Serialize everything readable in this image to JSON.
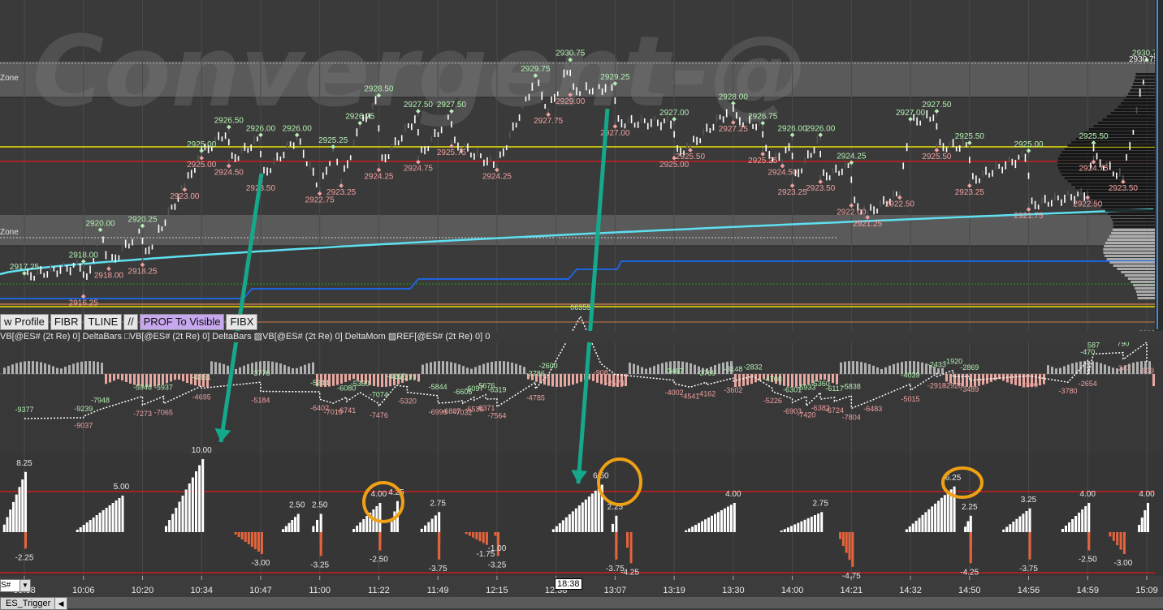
{
  "watermark": "Convergent-@",
  "zones": [
    "Zone",
    "Zone"
  ],
  "toolbar": [
    {
      "label": "w Profile",
      "active": false,
      "icon": null
    },
    {
      "label": "FIBR",
      "active": false,
      "icon": null
    },
    {
      "label": "TLINE",
      "active": false,
      "icon": null
    },
    {
      "label": "",
      "active": false,
      "icon": "parallel-lines-icon"
    },
    {
      "label": "PROF To Visible",
      "active": true,
      "icon": null
    },
    {
      "label": "FIBX",
      "active": false,
      "icon": null
    }
  ],
  "study_bar": "VB[@ES# (2t Re) 0] DeltaBars □VB[@ES# (2t Re) 0] DeltaBars ▨VB[@ES# (2t Re) 0] DeltaMom ▨REF[@ES# (2t Re) 0] 0",
  "time_axis": [
    "09:58",
    "10:06",
    "10:20",
    "10:34",
    "10:47",
    "11:00",
    "11:22",
    "11:49",
    "12:15",
    "12:38",
    "13:07",
    "13:19",
    "13:30",
    "14:00",
    "14:21",
    "14:32",
    "14:50",
    "14:56",
    "14:59",
    "15:09"
  ],
  "time_cursor": "18:38",
  "symbol_box": "S#",
  "bottom_tab": "ES_Trigger",
  "colors": {
    "background": "#3a3a3a",
    "highs": "#b4f0b4",
    "lows": "#f0a0a0",
    "vwap": "#5ee0f0",
    "blue_line": "#1e64dc",
    "yellow": "#f0e600",
    "red": "#c81e1e",
    "up_bar": "#ffffff",
    "down_bar": "#e6643c",
    "arrow": "#16a88a",
    "circle": "#f0a014"
  },
  "chart_data": [
    {
      "type": "price-bars",
      "price_labels_high": [
        {
          "label": "2917.25",
          "x": "09:58"
        },
        {
          "label": "2918.00",
          "x": "10:06"
        },
        {
          "label": "2920.00",
          "x": "10:10"
        },
        {
          "label": "2920.25",
          "x": "10:20"
        },
        {
          "label": "2925.00",
          "x": "10:34"
        },
        {
          "label": "2926.50",
          "x": "10:40"
        },
        {
          "label": "2926.00",
          "x": "10:47"
        },
        {
          "label": "2926.00",
          "x": "10:55"
        },
        {
          "label": "2925.25",
          "x": "11:05"
        },
        {
          "label": "2926.75",
          "x": "11:15"
        },
        {
          "label": "2928.50",
          "x": "11:22"
        },
        {
          "label": "2927.50",
          "x": "11:40"
        },
        {
          "label": "2927.50",
          "x": "11:55"
        },
        {
          "label": "2929.75",
          "x": "12:30"
        },
        {
          "label": "2930.75",
          "x": "12:45"
        },
        {
          "label": "2929.25",
          "x": "13:07"
        },
        {
          "label": "2927.00",
          "x": "13:19"
        },
        {
          "label": "2928.00",
          "x": "13:30"
        },
        {
          "label": "2926.75",
          "x": "13:45"
        },
        {
          "label": "2926.00",
          "x": "14:00"
        },
        {
          "label": "2926.00",
          "x": "14:10"
        },
        {
          "label": "2924.25",
          "x": "14:21"
        },
        {
          "label": "2927.00",
          "x": "14:32"
        },
        {
          "label": "2927.50",
          "x": "14:40"
        },
        {
          "label": "2925.50",
          "x": "14:50"
        },
        {
          "label": "2925.00",
          "x": "14:56"
        },
        {
          "label": "2925.50",
          "x": "15:00"
        },
        {
          "label": "2930.75",
          "x": "15:09"
        }
      ],
      "price_labels_low": [
        {
          "label": "2916.25",
          "x": "10:06"
        },
        {
          "label": "2918.00",
          "x": "10:12"
        },
        {
          "label": "2918.25",
          "x": "10:20"
        },
        {
          "label": "2923.00",
          "x": "10:30"
        },
        {
          "label": "2925.00",
          "x": "10:34"
        },
        {
          "label": "2924.50",
          "x": "10:40"
        },
        {
          "label": "2923.50",
          "x": "10:47"
        },
        {
          "label": "2922.75",
          "x": "11:00"
        },
        {
          "label": "2923.25",
          "x": "11:08"
        },
        {
          "label": "2924.25",
          "x": "11:22"
        },
        {
          "label": "2924.75",
          "x": "11:40"
        },
        {
          "label": "2925.75",
          "x": "11:55"
        },
        {
          "label": "2924.25",
          "x": "12:15"
        },
        {
          "label": "2927.75",
          "x": "12:35"
        },
        {
          "label": "2929.00",
          "x": "12:45"
        },
        {
          "label": "2927.00",
          "x": "13:07"
        },
        {
          "label": "2925.00",
          "x": "13:19"
        },
        {
          "label": "2925.50",
          "x": "13:22"
        },
        {
          "label": "2927.25",
          "x": "13:30"
        },
        {
          "label": "2925.25",
          "x": "13:45"
        },
        {
          "label": "2924.50",
          "x": "13:55"
        },
        {
          "label": "2923.25",
          "x": "14:00"
        },
        {
          "label": "2923.50",
          "x": "14:10"
        },
        {
          "label": "2922.00",
          "x": "14:21"
        },
        {
          "label": "2921.25",
          "x": "14:24"
        },
        {
          "label": "2922.50",
          "x": "14:30"
        },
        {
          "label": "2925.50",
          "x": "14:40"
        },
        {
          "label": "2923.25",
          "x": "14:50"
        },
        {
          "label": "2921.75",
          "x": "14:56"
        },
        {
          "label": "2922.50",
          "x": "14:59"
        },
        {
          "label": "2924.75",
          "x": "15:00"
        },
        {
          "label": "2923.50",
          "x": "15:05"
        }
      ],
      "right_axis_label": "2930.75"
    },
    {
      "type": "line",
      "name": "DeltaMom",
      "labels_high": [
        {
          "label": "-9377",
          "x": "09:58"
        },
        {
          "label": "-9239",
          "x": "10:06"
        },
        {
          "label": "-7948",
          "x": "10:10"
        },
        {
          "label": "-5946",
          "x": "10:20"
        },
        {
          "label": "-5937",
          "x": "10:25"
        },
        {
          "label": "-4351",
          "x": "10:34"
        },
        {
          "label": "-3776",
          "x": "10:47"
        },
        {
          "label": "-5244",
          "x": "11:00"
        },
        {
          "label": "-6080",
          "x": "11:10"
        },
        {
          "label": "-5360",
          "x": "11:15"
        },
        {
          "label": "-7074",
          "x": "11:22"
        },
        {
          "label": "-4267",
          "x": "11:30"
        },
        {
          "label": "-4477",
          "x": "11:35"
        },
        {
          "label": "-5844",
          "x": "11:49"
        },
        {
          "label": "-6606",
          "x": "12:00"
        },
        {
          "label": "-6097",
          "x": "12:05"
        },
        {
          "label": "-5676",
          "x": "12:10"
        },
        {
          "label": "-6319",
          "x": "12:15"
        },
        {
          "label": "-3786",
          "x": "12:30"
        },
        {
          "label": "-2600",
          "x": "12:35"
        },
        {
          "label": "06359",
          "x": "12:50"
        },
        {
          "label": "-3467",
          "x": "13:19"
        },
        {
          "label": "-3769",
          "x": "13:25"
        },
        {
          "label": "-3148",
          "x": "13:30"
        },
        {
          "label": "-2832",
          "x": "13:40"
        },
        {
          "label": "-4708",
          "x": "13:50"
        },
        {
          "label": "-6301",
          "x": "14:00"
        },
        {
          "label": "-5933",
          "x": "14:05"
        },
        {
          "label": "-5360",
          "x": "14:10"
        },
        {
          "label": "-6117",
          "x": "14:15"
        },
        {
          "label": "-5838",
          "x": "14:21"
        },
        {
          "label": "-4039",
          "x": "14:32"
        },
        {
          "label": "-2433",
          "x": "14:40"
        },
        {
          "label": "-1920",
          "x": "14:45"
        },
        {
          "label": "-2869",
          "x": "14:50"
        },
        {
          "label": "-470",
          "x": "14:59"
        },
        {
          "label": "587",
          "x": "15:00"
        },
        {
          "label": "790",
          "x": "15:05"
        },
        {
          "label": "2362",
          "x": "15:09"
        }
      ],
      "labels_low": [
        {
          "label": "-9037",
          "x": "10:06"
        },
        {
          "label": "-7273",
          "x": "10:20"
        },
        {
          "label": "-7065",
          "x": "10:25"
        },
        {
          "label": "-4695",
          "x": "10:34"
        },
        {
          "label": "-5184",
          "x": "10:47"
        },
        {
          "label": "-6402",
          "x": "11:00"
        },
        {
          "label": "-7010",
          "x": "11:05"
        },
        {
          "label": "-6741",
          "x": "11:10"
        },
        {
          "label": "-7476",
          "x": "11:22"
        },
        {
          "label": "-5320",
          "x": "11:35"
        },
        {
          "label": "-6996",
          "x": "11:49"
        },
        {
          "label": "-6887",
          "x": "11:55"
        },
        {
          "label": "-7032",
          "x": "12:00"
        },
        {
          "label": "-6536",
          "x": "12:05"
        },
        {
          "label": "-6371",
          "x": "12:10"
        },
        {
          "label": "-7564",
          "x": "12:15"
        },
        {
          "label": "-4785",
          "x": "12:30"
        },
        {
          "label": "-908",
          "x": "13:00"
        },
        {
          "label": "-2574",
          "x": "13:07"
        },
        {
          "label": "-4002",
          "x": "13:19"
        },
        {
          "label": "-4541",
          "x": "13:22"
        },
        {
          "label": "-4162",
          "x": "13:25"
        },
        {
          "label": "-3602",
          "x": "13:30"
        },
        {
          "label": "-5226",
          "x": "13:50"
        },
        {
          "label": "-6903",
          "x": "14:00"
        },
        {
          "label": "-7420",
          "x": "14:05"
        },
        {
          "label": "-6382",
          "x": "14:10"
        },
        {
          "label": "-6724",
          "x": "14:15"
        },
        {
          "label": "-7804",
          "x": "14:21"
        },
        {
          "label": "-6483",
          "x": "14:25"
        },
        {
          "label": "-5015",
          "x": "14:32"
        },
        {
          "label": "-2918",
          "x": "14:40"
        },
        {
          "label": "-2928",
          "x": "14:45"
        },
        {
          "label": "-3489",
          "x": "14:50"
        },
        {
          "label": "-2800",
          "x": "14:56"
        },
        {
          "label": "-3780",
          "x": "14:58"
        },
        {
          "label": "-2654",
          "x": "14:59"
        },
        {
          "label": "-247",
          "x": "15:05"
        },
        {
          "label": "-609",
          "x": "15:09"
        }
      ]
    },
    {
      "type": "bar",
      "name": "DeltaBars",
      "labels_high": [
        {
          "label": "8.25",
          "x": "09:58"
        },
        {
          "label": "5.00",
          "x": "10:15"
        },
        {
          "label": "10.00",
          "x": "10:34"
        },
        {
          "label": "2.50",
          "x": "10:55"
        },
        {
          "label": "2.50",
          "x": "11:00"
        },
        {
          "label": "4.00",
          "x": "11:22"
        },
        {
          "label": "4.25",
          "x": "11:30"
        },
        {
          "label": "2.75",
          "x": "11:49"
        },
        {
          "label": "-1.00",
          "x": "12:15"
        },
        {
          "label": "6.50",
          "x": "13:00"
        },
        {
          "label": "2.25",
          "x": "13:07"
        },
        {
          "label": "4.00",
          "x": "13:30"
        },
        {
          "label": "2.75",
          "x": "14:10"
        },
        {
          "label": "6.25",
          "x": "14:45"
        },
        {
          "label": "2.25",
          "x": "14:50"
        },
        {
          "label": "3.25",
          "x": "14:56"
        },
        {
          "label": "4.00",
          "x": "14:59"
        },
        {
          "label": "4.00",
          "x": "15:09"
        }
      ],
      "labels_low": [
        {
          "label": "-2.25",
          "x": "09:58"
        },
        {
          "label": "-3.00",
          "x": "10:47"
        },
        {
          "label": "-3.25",
          "x": "11:00"
        },
        {
          "label": "-2.50",
          "x": "11:22"
        },
        {
          "label": "-3.75",
          "x": "11:49"
        },
        {
          "label": "-1.75",
          "x": "12:10"
        },
        {
          "label": "-3.25",
          "x": "12:15"
        },
        {
          "label": "-3.75",
          "x": "13:07"
        },
        {
          "label": "-4.25",
          "x": "13:10"
        },
        {
          "label": "-4.75",
          "x": "14:21"
        },
        {
          "label": "-4.25",
          "x": "14:50"
        },
        {
          "label": "-3.75",
          "x": "14:56"
        },
        {
          "label": "-2.50",
          "x": "14:59"
        },
        {
          "label": "-3.00",
          "x": "15:05"
        }
      ]
    }
  ]
}
